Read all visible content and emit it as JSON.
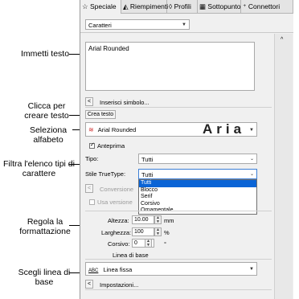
{
  "tabs": [
    {
      "label": "Speciale",
      "icon": "star-icon"
    },
    {
      "label": "Riempimenti",
      "icon": "fill-icon"
    },
    {
      "label": "Profili",
      "icon": "outline-icon"
    },
    {
      "label": "Sottopunto",
      "icon": "underlay-icon"
    },
    {
      "label": "Connettori",
      "icon": "connector-icon"
    }
  ],
  "object_type_select": {
    "value": "Caratteri"
  },
  "text_input": {
    "value": "Arial Rounded"
  },
  "insert_symbol_label": "Inserisci simbolo...",
  "create_text_button": "Crea testo",
  "alphabet_select": {
    "value": "Arial Rounded",
    "preview": "Aria"
  },
  "preview_checkbox": {
    "label": "Anteprima",
    "checked": true
  },
  "type_row": {
    "label": "Tipo:",
    "value": "Tutti"
  },
  "truetype_row": {
    "label": "Stile TrueType:",
    "value": "Tutti"
  },
  "truetype_options": [
    "Tutti",
    "Blocco",
    "Serif",
    "Corsivo",
    "Ornamentale"
  ],
  "convert_label": "Conversione",
  "use_version_label": "Usa versione",
  "height_row": {
    "label": "Altezza:",
    "value": "10.00",
    "unit": "mm"
  },
  "width_row": {
    "label": "Larghezza:",
    "value": "100",
    "unit": "%"
  },
  "italic_row": {
    "label": "Corsivo:",
    "value": "0",
    "unit": "°"
  },
  "baseline_label": "Linea di base",
  "baseline_select": {
    "icon": "ABC",
    "value": "Linea fissa"
  },
  "settings_label": "Impostazioni...",
  "callouts": {
    "enter_text": "Immetti testo",
    "click_create": "Clicca per creare testo",
    "select_alphabet": "Seleziona alfabeto",
    "filter_list": "Filtra l'elenco tipi di carattere",
    "adjust_format": "Regola la formattazione",
    "choose_baseline": "Scegli linea di base"
  },
  "colors": {
    "selected_item": "#0a64d6",
    "panel": "#f0f0f0"
  }
}
